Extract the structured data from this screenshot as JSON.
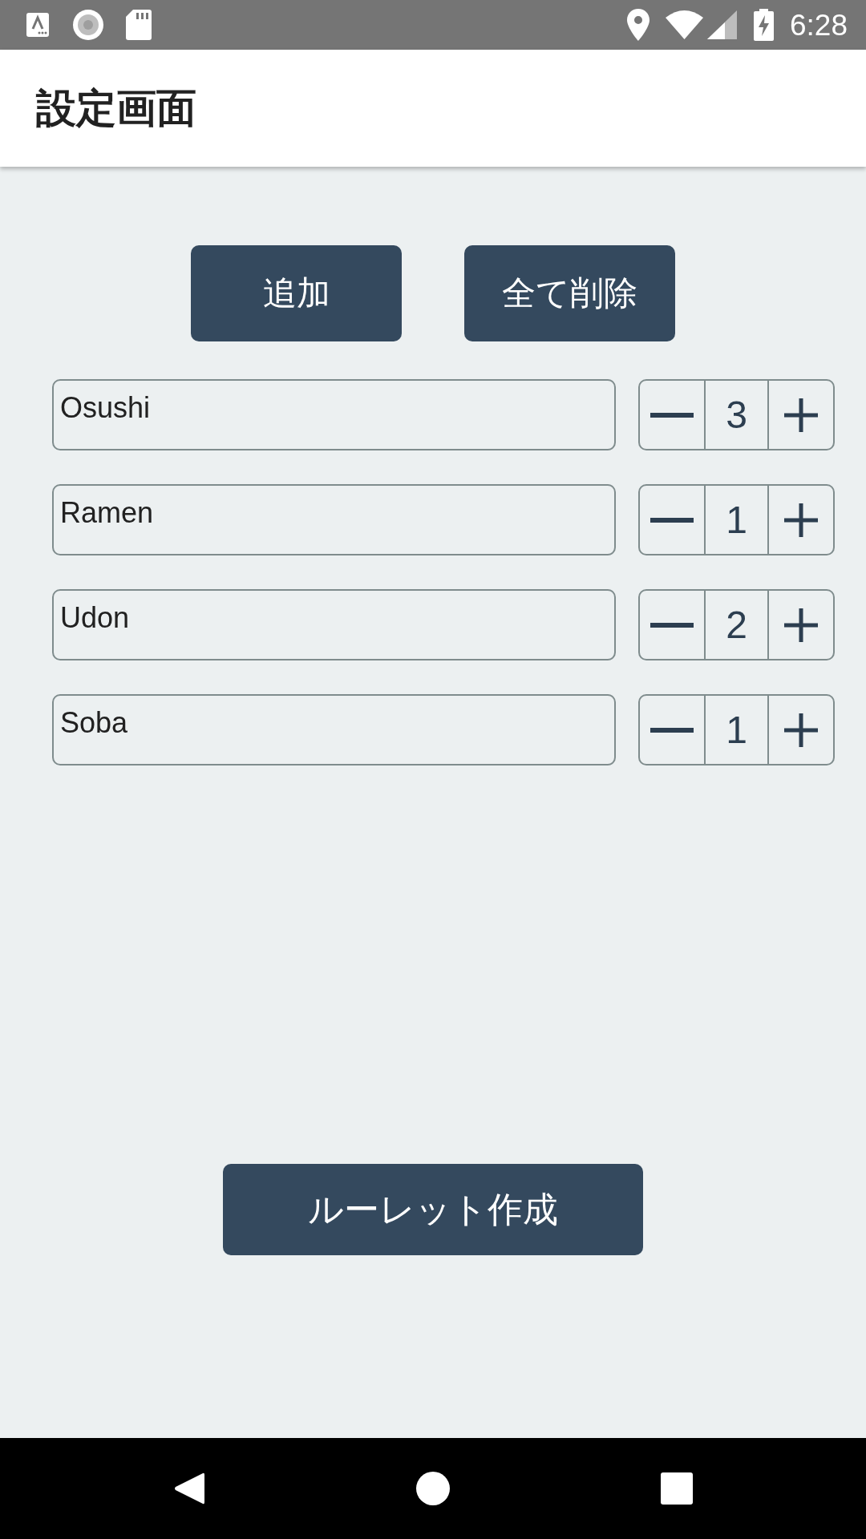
{
  "status_bar": {
    "time": "6:28"
  },
  "app_bar": {
    "title": "設定画面"
  },
  "actions": [
    {
      "label": "追加"
    },
    {
      "label": "全て削除"
    }
  ],
  "items": [
    {
      "name": "Osushi",
      "count": "3"
    },
    {
      "name": "Ramen",
      "count": "1"
    },
    {
      "name": "Udon",
      "count": "2"
    },
    {
      "name": "Soba",
      "count": "1"
    }
  ],
  "create_button": {
    "label": "ルーレット作成"
  }
}
